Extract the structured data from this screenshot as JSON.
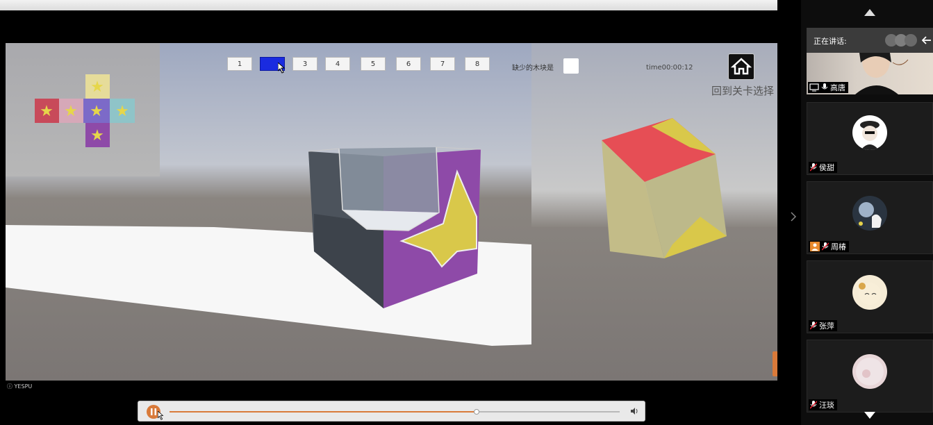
{
  "game": {
    "level_buttons": [
      "1",
      "",
      "3",
      "4",
      "5",
      "6",
      "7",
      "8"
    ],
    "active_level": 2,
    "missing_blocks_label": "缺少的木块是",
    "timer": "time00:00:12",
    "back_to_level_select": "回到关卡选择",
    "watermark": "YESPU"
  },
  "player": {
    "progress": 0.68,
    "state": "playing"
  },
  "sidebar": {
    "speaking_label": "正在讲话:",
    "participants": [
      {
        "name": "高唐",
        "icon": "screen-share-icon"
      },
      {
        "name": "侯甜",
        "icon": "mic-muted-icon"
      },
      {
        "name": "周椿",
        "icon": "mic-muted-icon"
      },
      {
        "name": "张萍",
        "icon": "mic-muted-icon"
      },
      {
        "name": "汪琰",
        "icon": "mic-muted-icon"
      }
    ]
  },
  "colors": {
    "accent_orange": "#d97a3a",
    "active_level_blue": "#1a2be0",
    "cube_purple": "#8e4aa8",
    "star_yellow": "#d9c84a"
  }
}
